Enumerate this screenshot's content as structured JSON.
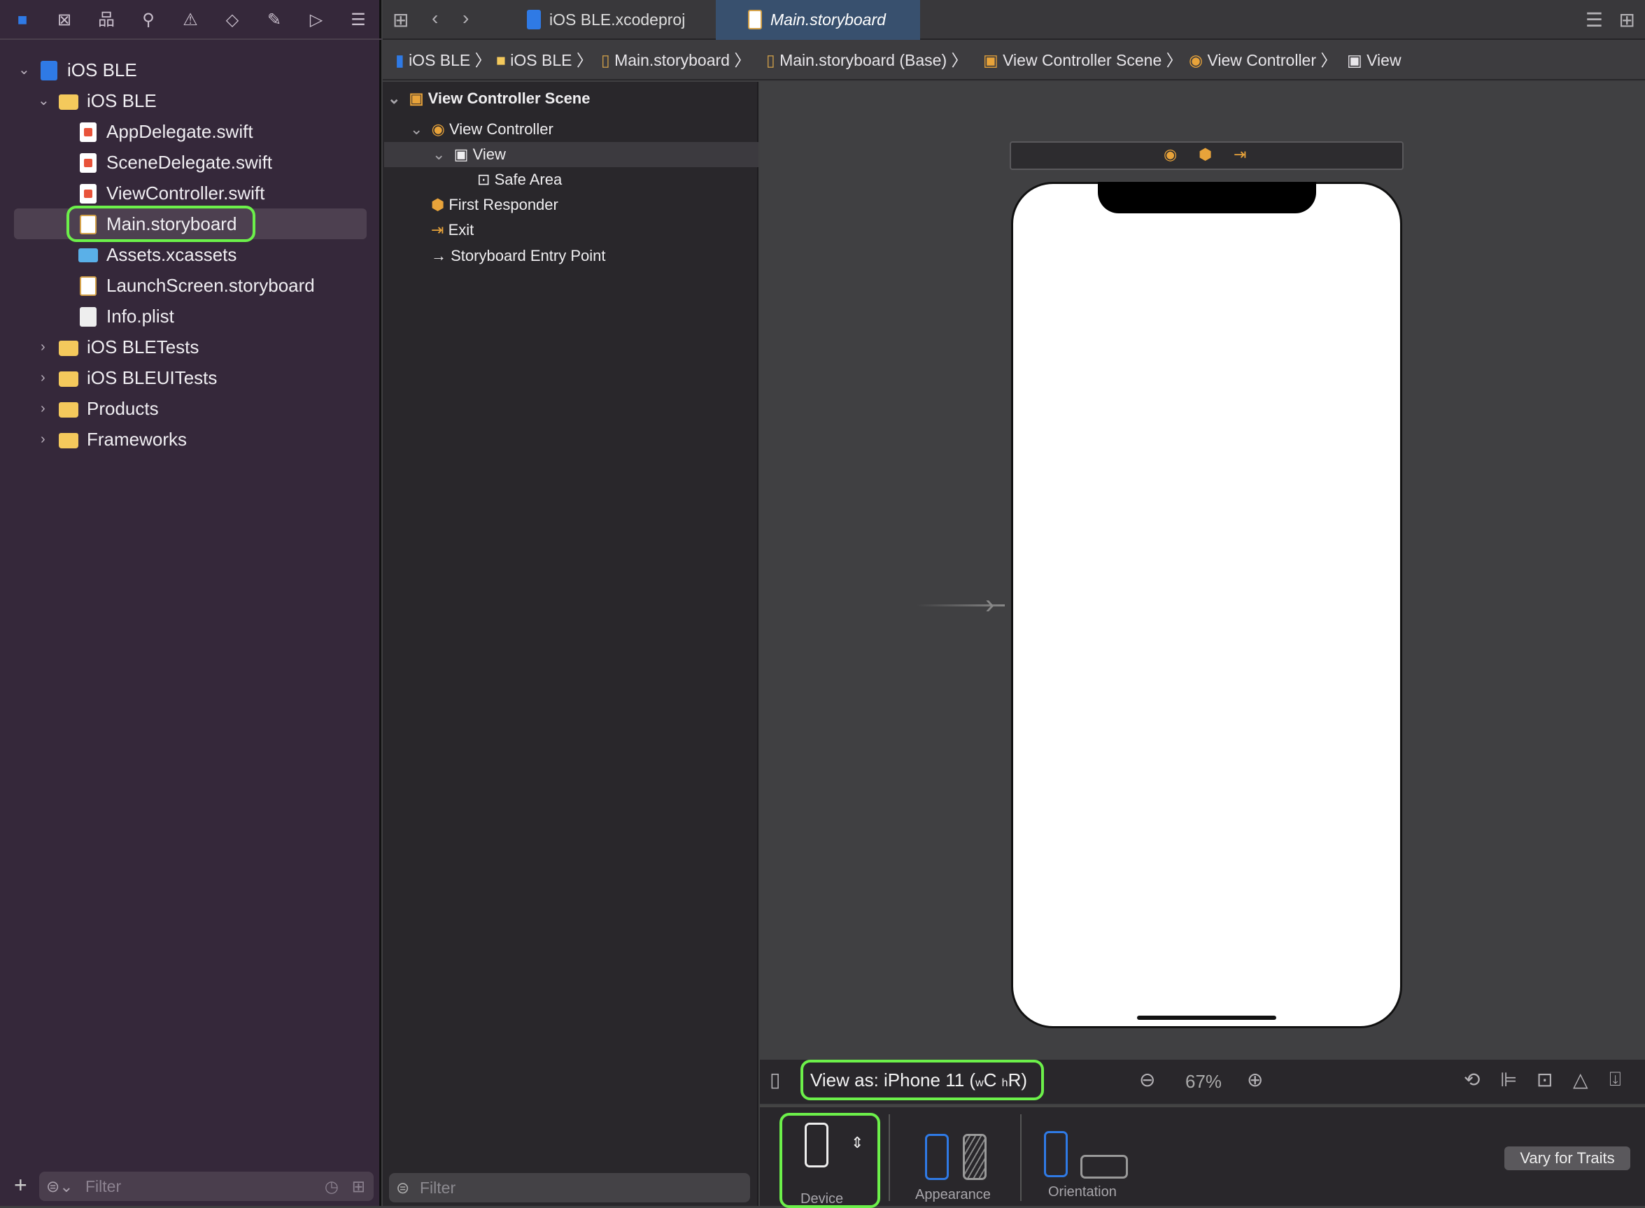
{
  "navigator": {
    "toolbar_icons": [
      "folder-icon",
      "source-control-icon",
      "hierarchy-icon",
      "search-icon",
      "warning-icon",
      "test-icon",
      "debug-icon",
      "breakpoint-icon",
      "report-icon"
    ],
    "tree": [
      {
        "label": "iOS BLE",
        "icon": "project-icon",
        "expanded": true
      },
      {
        "label": "iOS BLE",
        "icon": "folder-icon",
        "expanded": true
      },
      {
        "label": "AppDelegate.swift",
        "icon": "swift-file-icon"
      },
      {
        "label": "SceneDelegate.swift",
        "icon": "swift-file-icon"
      },
      {
        "label": "ViewController.swift",
        "icon": "swift-file-icon"
      },
      {
        "label": "Main.storyboard",
        "icon": "storyboard-icon",
        "selected": true
      },
      {
        "label": "Assets.xcassets",
        "icon": "assets-icon"
      },
      {
        "label": "LaunchScreen.storyboard",
        "icon": "storyboard-icon"
      },
      {
        "label": "Info.plist",
        "icon": "plist-icon"
      },
      {
        "label": "iOS BLETests",
        "icon": "folder-icon",
        "expanded": false
      },
      {
        "label": "iOS BLEUITests",
        "icon": "folder-icon",
        "expanded": false
      },
      {
        "label": "Products",
        "icon": "folder-icon",
        "expanded": false
      },
      {
        "label": "Frameworks",
        "icon": "folder-icon",
        "expanded": false
      }
    ],
    "filter_placeholder": "Filter"
  },
  "tabs": [
    {
      "label": "iOS BLE.xcodeproj",
      "active": false
    },
    {
      "label": "Main.storyboard",
      "active": true
    }
  ],
  "breadcrumbs": [
    "iOS BLE",
    "iOS BLE",
    "Main.storyboard",
    "Main.storyboard (Base)",
    "View Controller Scene",
    "View Controller",
    "View"
  ],
  "outline": {
    "items": [
      "View Controller Scene",
      "View Controller",
      "View",
      "Safe Area",
      "First Responder",
      "Exit",
      "Storyboard Entry Point"
    ],
    "filter_placeholder": "Filter"
  },
  "canvas": {
    "view_as": "View as: iPhone 11 (",
    "size_w": "w",
    "size_wc": "C",
    "size_h": "h",
    "size_hr": "R",
    "view_as_close": ")",
    "zoom": "67%"
  },
  "traits": {
    "device": "Device",
    "appearance": "Appearance",
    "orientation": "Orientation",
    "vary": "Vary for Traits"
  },
  "colors": {
    "highlight": "#6cf04a",
    "selected_tab": "#38506e",
    "accent": "#2f7ae5"
  }
}
